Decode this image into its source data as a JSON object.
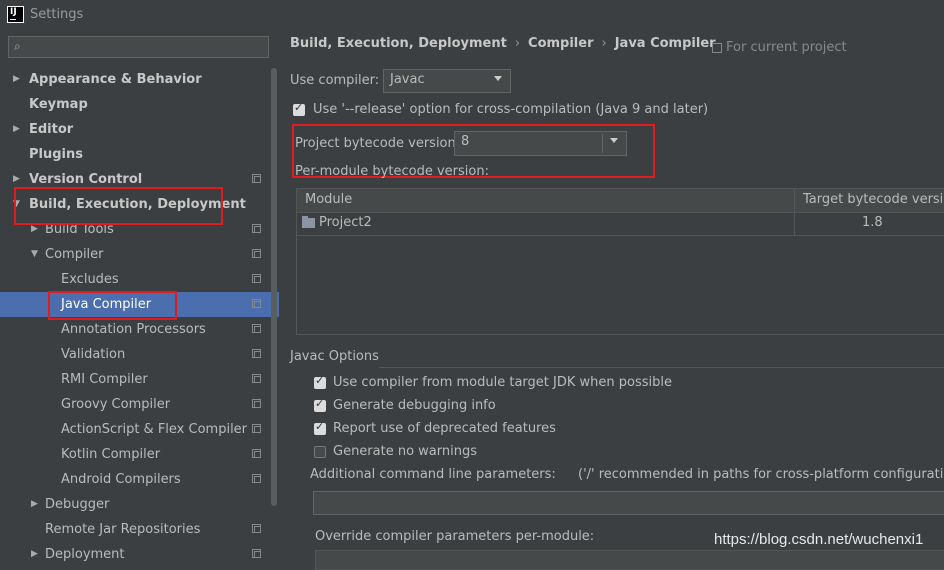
{
  "window": {
    "title": "Settings"
  },
  "sidebar": {
    "items": [
      {
        "label": "Appearance & Behavior"
      },
      {
        "label": "Keymap"
      },
      {
        "label": "Editor"
      },
      {
        "label": "Plugins"
      },
      {
        "label": "Version Control"
      },
      {
        "label": "Build, Execution, Deployment"
      },
      {
        "label": "Build Tools"
      },
      {
        "label": "Compiler"
      },
      {
        "label": "Excludes"
      },
      {
        "label": "Java Compiler"
      },
      {
        "label": "Annotation Processors"
      },
      {
        "label": "Validation"
      },
      {
        "label": "RMI Compiler"
      },
      {
        "label": "Groovy Compiler"
      },
      {
        "label": "ActionScript & Flex Compiler"
      },
      {
        "label": "Kotlin Compiler"
      },
      {
        "label": "Android Compilers"
      },
      {
        "label": "Debugger"
      },
      {
        "label": "Remote Jar Repositories"
      },
      {
        "label": "Deployment"
      }
    ]
  },
  "breadcrumb": {
    "items": [
      "Build, Execution, Deployment",
      "Compiler",
      "Java Compiler"
    ],
    "separator": "›",
    "for_project": "For current project"
  },
  "compiler": {
    "use_label": "Use compiler:",
    "use_value": "Javac",
    "release_label": "Use '--release' option for cross-compilation (Java 9 and later)",
    "release_checked": true,
    "bytecode_label": "Project bytecode version:",
    "bytecode_value": "8",
    "per_module_label": "Per-module bytecode version:"
  },
  "module_table": {
    "headers": [
      "Module",
      "Target bytecode version"
    ],
    "rows": [
      {
        "module": "Project2",
        "target": "1.8"
      }
    ]
  },
  "javac": {
    "group_label": "Javac Options",
    "options": [
      {
        "label": "Use compiler from module target JDK when possible",
        "checked": true
      },
      {
        "label": "Generate debugging info",
        "checked": true
      },
      {
        "label": "Report use of deprecated features",
        "checked": true
      },
      {
        "label": "Generate no warnings",
        "checked": false
      }
    ],
    "params_label": "Additional command line parameters:",
    "params_hint": "('/' recommended in paths for cross-platform configurations)",
    "params_value": "",
    "override_label": "Override compiler parameters per-module:"
  },
  "watermark": "https://blog.csdn.net/wuchenxi1",
  "colors": {
    "selection": "#4b6eaf",
    "highlight_box": "#e01c1c",
    "background": "#3c3f41"
  }
}
